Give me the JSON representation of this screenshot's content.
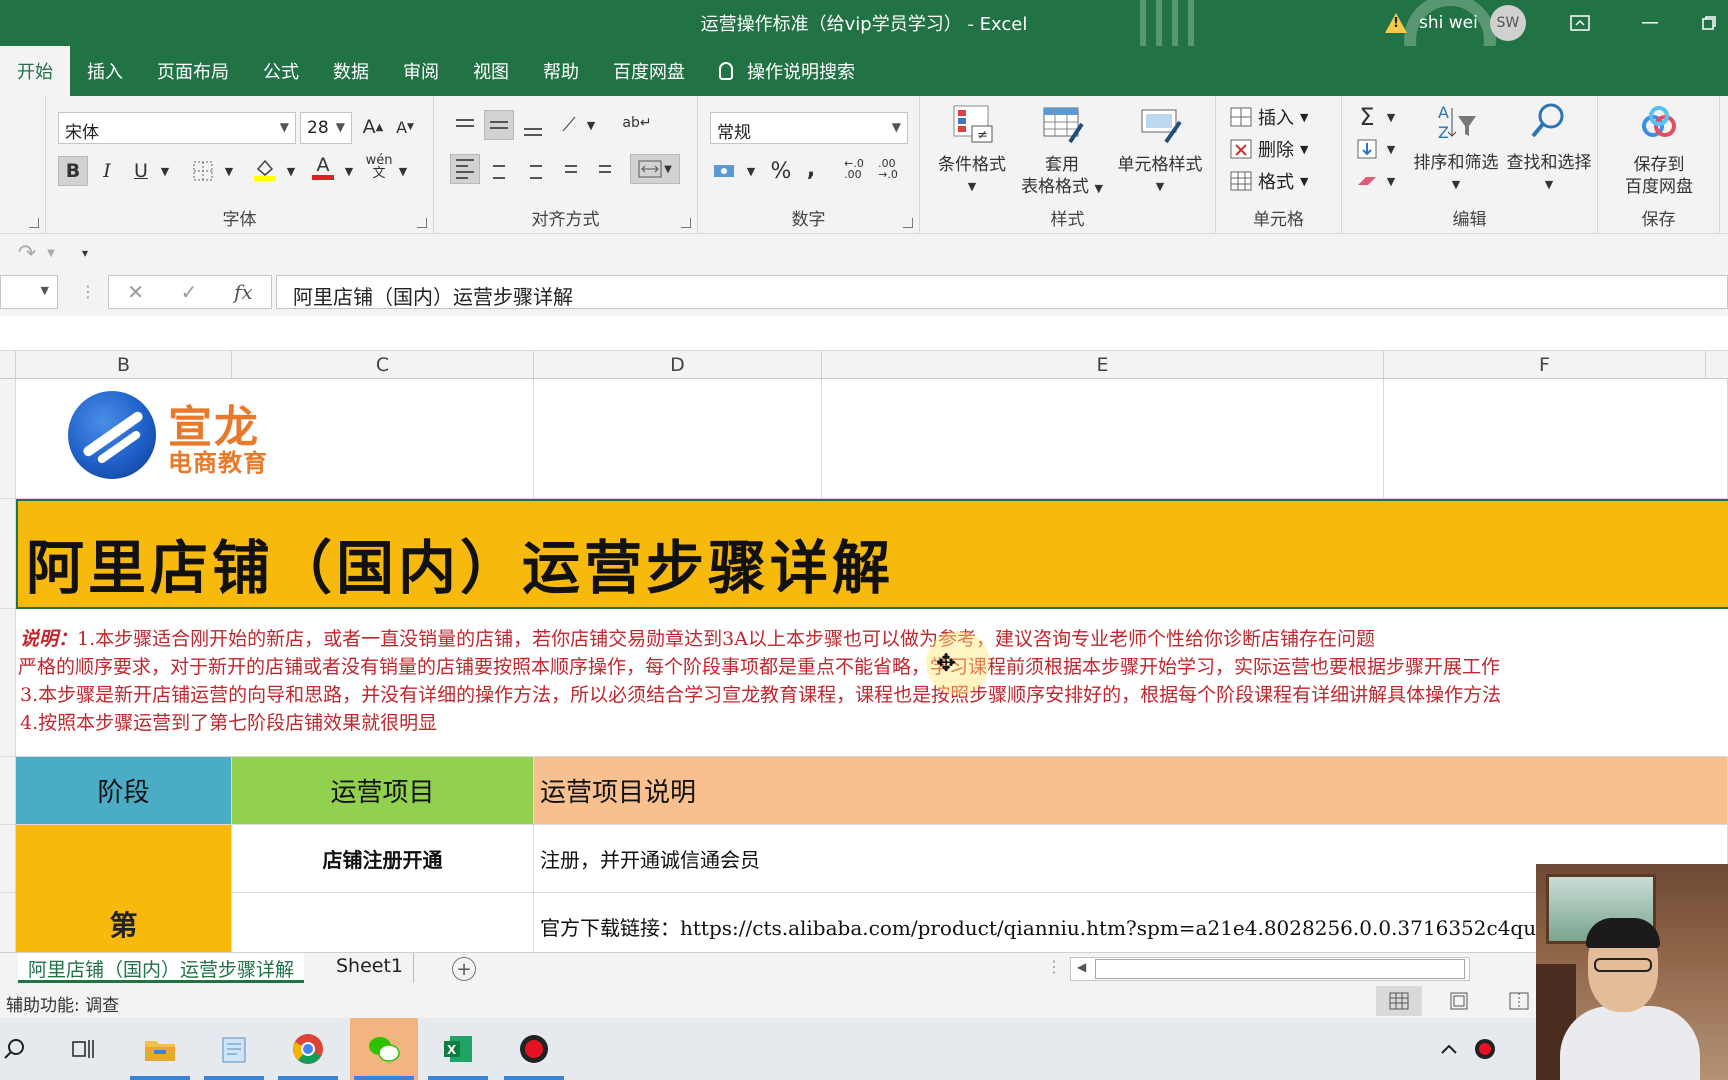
{
  "window": {
    "title": "运营操作标准（给vip学员学习） - Excel",
    "user_name": "shi wei",
    "user_initials": "SW"
  },
  "ribbon_tabs": [
    "开始",
    "插入",
    "页面布局",
    "公式",
    "数据",
    "审阅",
    "视图",
    "帮助",
    "百度网盘"
  ],
  "search_tab": "操作说明搜索",
  "ribbon": {
    "font_name": "宋体",
    "font_size": "28",
    "number_format": "常规",
    "font_color_glyph": "A",
    "pinyin_glyph": "wén\n文",
    "group_labels": {
      "font": "字体",
      "alignment": "对齐方式",
      "number": "数字",
      "styles": "样式",
      "cells": "单元格",
      "editing": "编辑",
      "save": "保存"
    },
    "styles_buttons": {
      "conditional": "条件格式",
      "table_line1": "套用",
      "table_line2": "表格格式",
      "cell_styles": "单元格样式"
    },
    "cells_buttons": {
      "insert": "插入",
      "delete": "删除",
      "format": "格式"
    },
    "editing_buttons": {
      "sort": "排序和筛选",
      "find": "查找和选择"
    },
    "save_button_line1": "保存到",
    "save_button_line2": "百度网盘"
  },
  "formula_bar": {
    "content": "阿里店铺（国内）运营步骤详解",
    "fx": "fx"
  },
  "columns": [
    "B",
    "C",
    "D",
    "E",
    "F"
  ],
  "sheet": {
    "logo_line1": "宣龙",
    "logo_line2": "电商教育",
    "banner_title": "阿里店铺（国内）运营步骤详解",
    "notes_label": "说明：",
    "notes": [
      "1.本步骤适合刚开始的新店，或者一直没销量的店铺，若你店铺交易勋章达到3A以上本步骤也可以做为参考，建议咨询专业老师个性给你诊断店铺存在问题",
      "严格的顺序要求，对于新开的店铺或者没有销量的店铺要按照本顺序操作，每个阶段事项都是重点不能省略，学习课程前须根据本步骤开始学习，实际运营也要根据步骤开展工作",
      "3.本步骤是新开店铺运营的向导和思路，并没有详细的操作方法，所以必须结合学习宣龙教育课程，课程也是按照步骤顺序安排好的，根据每个阶段课程有详细讲解具体操作方法",
      "4.按照本步骤运营到了第七阶段店铺效果就很明显"
    ],
    "table_headers": [
      "阶段",
      "运营项目",
      "运营项目说明"
    ],
    "stage_label": "第",
    "row1": {
      "item": "店铺注册开通",
      "desc": "注册，并开通诚信通会员"
    },
    "row2": {
      "item": "",
      "desc": "官方下载链接：https://cts.alibaba.com/product/qianniu.htm?spm=a21e4.8028256.0.0.3716352c4qu"
    }
  },
  "sheet_tabs": [
    "阿里店铺（国内）运营步骤详解",
    "Sheet1"
  ],
  "status_bar": {
    "accessibility": "辅助功能: 调查"
  },
  "colors": {
    "excel_green": "#217346",
    "banner_yellow": "#f6b90c",
    "note_red": "#c1272d",
    "header_blue": "#4bacc6",
    "header_green": "#92d050",
    "header_peach": "#f8c08f"
  }
}
